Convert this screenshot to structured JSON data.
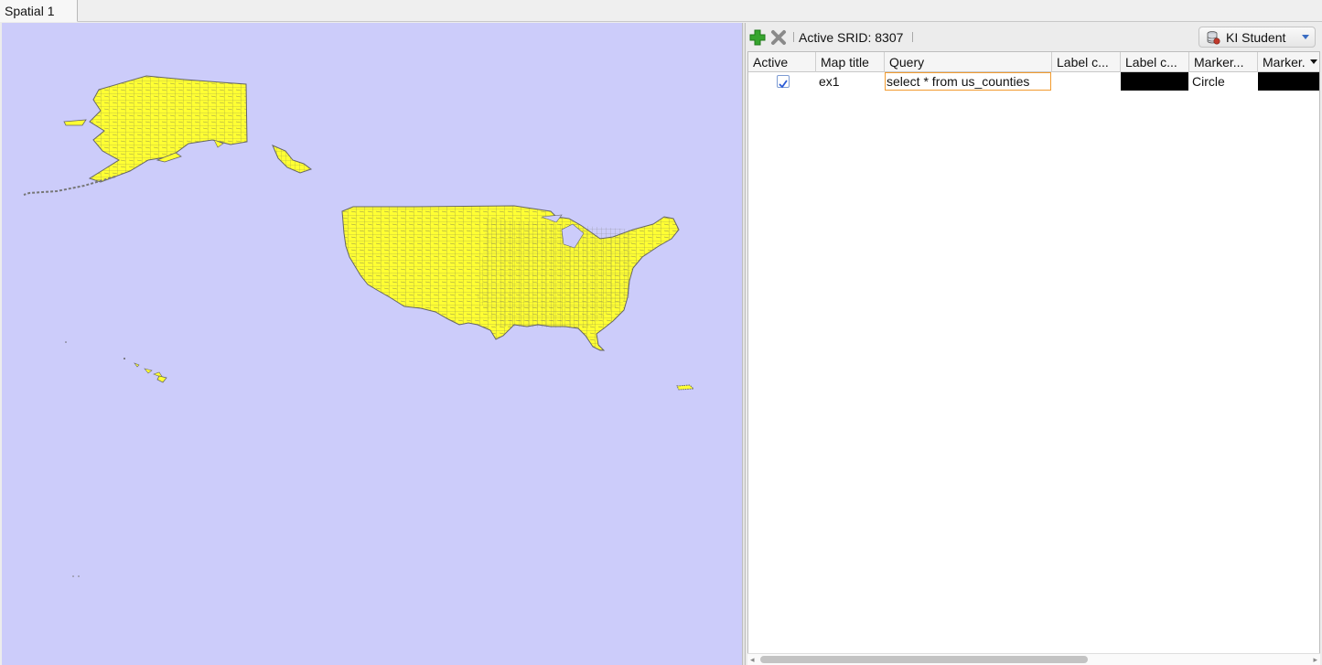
{
  "tab": {
    "label": "Spatial 1"
  },
  "map": {
    "background": "#ccccfa",
    "fill": "#ffff33",
    "stroke": "#666666"
  },
  "toolbar": {
    "add_icon": "add-plus-icon",
    "remove_icon": "remove-x-icon",
    "srid_label": "Active SRID: 8307",
    "connection_label": "KI Student",
    "connection_icon": "database-icon"
  },
  "table": {
    "columns": [
      "Active",
      "Map title",
      "Query",
      "Label c...",
      "Label c...",
      "Marker...",
      "Marker."
    ],
    "rows": [
      {
        "active": true,
        "map_title": "ex1",
        "query": "select * from us_counties",
        "label_column": "",
        "label_color": "#000000",
        "marker_shape": "Circle",
        "marker_color": "#000000"
      }
    ]
  }
}
